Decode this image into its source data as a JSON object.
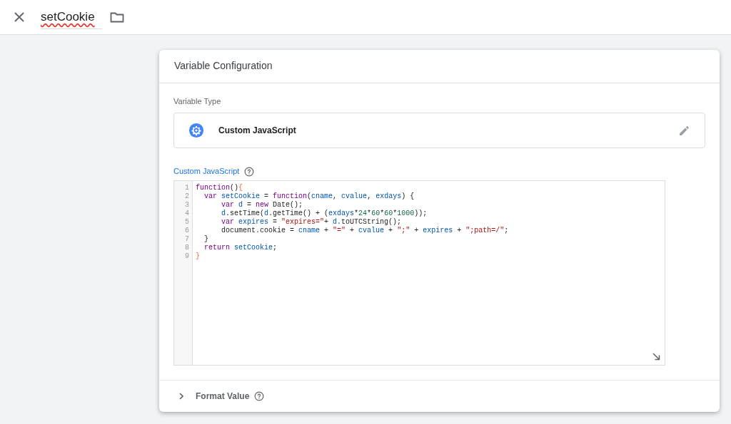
{
  "header": {
    "name": "setCookie"
  },
  "card": {
    "title": "Variable Configuration",
    "variable_type_label": "Variable Type",
    "variable_type": "Custom JavaScript",
    "code_label": "Custom JavaScript",
    "code_lines": [
      {
        "number": "1",
        "tokens": [
          {
            "t": "function",
            "kind": "keyword"
          },
          {
            "t": "()",
            "kind": "plain"
          },
          {
            "t": "{",
            "kind": "bracket"
          }
        ]
      },
      {
        "number": "2",
        "tokens": [
          {
            "t": "  var ",
            "kind": "keyword"
          },
          {
            "t": "setCookie",
            "kind": "def"
          },
          {
            "t": " = ",
            "kind": "plain"
          },
          {
            "t": "function",
            "kind": "keyword"
          },
          {
            "t": "(",
            "kind": "plain"
          },
          {
            "t": "cname",
            "kind": "def"
          },
          {
            "t": ", ",
            "kind": "plain"
          },
          {
            "t": "cvalue",
            "kind": "def"
          },
          {
            "t": ", ",
            "kind": "plain"
          },
          {
            "t": "exdays",
            "kind": "def"
          },
          {
            "t": ") {",
            "kind": "plain"
          }
        ]
      },
      {
        "number": "3",
        "tokens": [
          {
            "t": "      var ",
            "kind": "keyword"
          },
          {
            "t": "d",
            "kind": "def"
          },
          {
            "t": " = ",
            "kind": "plain"
          },
          {
            "t": "new",
            "kind": "keyword"
          },
          {
            "t": " Date();",
            "kind": "plain"
          }
        ]
      },
      {
        "number": "4",
        "tokens": [
          {
            "t": "      d",
            "kind": "def"
          },
          {
            "t": ".setTime(",
            "kind": "plain"
          },
          {
            "t": "d",
            "kind": "def"
          },
          {
            "t": ".getTime() + (",
            "kind": "plain"
          },
          {
            "t": "exdays",
            "kind": "def"
          },
          {
            "t": "*",
            "kind": "plain"
          },
          {
            "t": "24",
            "kind": "number"
          },
          {
            "t": "*",
            "kind": "plain"
          },
          {
            "t": "60",
            "kind": "number"
          },
          {
            "t": "*",
            "kind": "plain"
          },
          {
            "t": "60",
            "kind": "number"
          },
          {
            "t": "*",
            "kind": "plain"
          },
          {
            "t": "1000",
            "kind": "number"
          },
          {
            "t": "));",
            "kind": "plain"
          }
        ]
      },
      {
        "number": "5",
        "tokens": [
          {
            "t": "      var ",
            "kind": "keyword"
          },
          {
            "t": "expires",
            "kind": "def"
          },
          {
            "t": " = ",
            "kind": "plain"
          },
          {
            "t": "\"expires=\"",
            "kind": "string"
          },
          {
            "t": "+ ",
            "kind": "plain"
          },
          {
            "t": "d",
            "kind": "def"
          },
          {
            "t": ".toUTCString();",
            "kind": "plain"
          }
        ]
      },
      {
        "number": "6",
        "tokens": [
          {
            "t": "      document.cookie = ",
            "kind": "plain"
          },
          {
            "t": "cname",
            "kind": "def"
          },
          {
            "t": " + ",
            "kind": "plain"
          },
          {
            "t": "\"=\"",
            "kind": "string"
          },
          {
            "t": " + ",
            "kind": "plain"
          },
          {
            "t": "cvalue",
            "kind": "def"
          },
          {
            "t": " + ",
            "kind": "plain"
          },
          {
            "t": "\";\"",
            "kind": "string"
          },
          {
            "t": " + ",
            "kind": "plain"
          },
          {
            "t": "expires",
            "kind": "def"
          },
          {
            "t": " + ",
            "kind": "plain"
          },
          {
            "t": "\";path=/\"",
            "kind": "string"
          },
          {
            "t": ";",
            "kind": "plain"
          }
        ]
      },
      {
        "number": "7",
        "tokens": [
          {
            "t": "  }",
            "kind": "plain"
          }
        ]
      },
      {
        "number": "8",
        "tokens": [
          {
            "t": "  return ",
            "kind": "keyword"
          },
          {
            "t": "setCookie",
            "kind": "def"
          },
          {
            "t": ";",
            "kind": "plain"
          }
        ]
      },
      {
        "number": "9",
        "tokens": [
          {
            "t": "}",
            "kind": "bracket"
          }
        ]
      }
    ],
    "format_value": {
      "label": "Format Value",
      "expanded": false
    }
  }
}
